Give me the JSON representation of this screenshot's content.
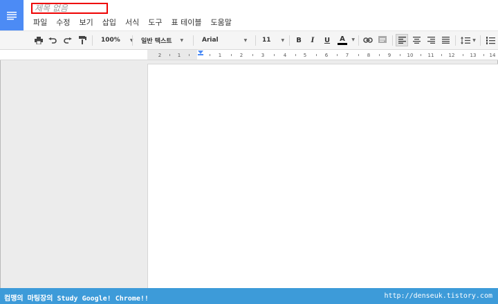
{
  "app": {
    "doc_title": "제목 없음"
  },
  "menu": [
    "파일",
    "수정",
    "보기",
    "삽입",
    "서식",
    "도구",
    "표",
    "테이블",
    "도움말"
  ],
  "toolbar": {
    "zoom": "100%",
    "style": "일반 텍스트",
    "font": "Arial",
    "size": "11",
    "bold": "B",
    "italic": "I",
    "underline": "U",
    "text_color": "A"
  },
  "ruler": {
    "labels": [
      "2",
      "1",
      "1",
      "2",
      "3",
      "4",
      "5",
      "6",
      "7",
      "8",
      "9",
      "10",
      "11",
      "12",
      "13",
      "14"
    ]
  },
  "footer": {
    "left": "컴맹의 마팅장의 Study Google! Chrome!!",
    "right": "http://denseuk.tistory.com"
  },
  "colors": {
    "accent": "#4c8bf5",
    "footer": "#3d9bd9",
    "title_border": "#e00000"
  }
}
